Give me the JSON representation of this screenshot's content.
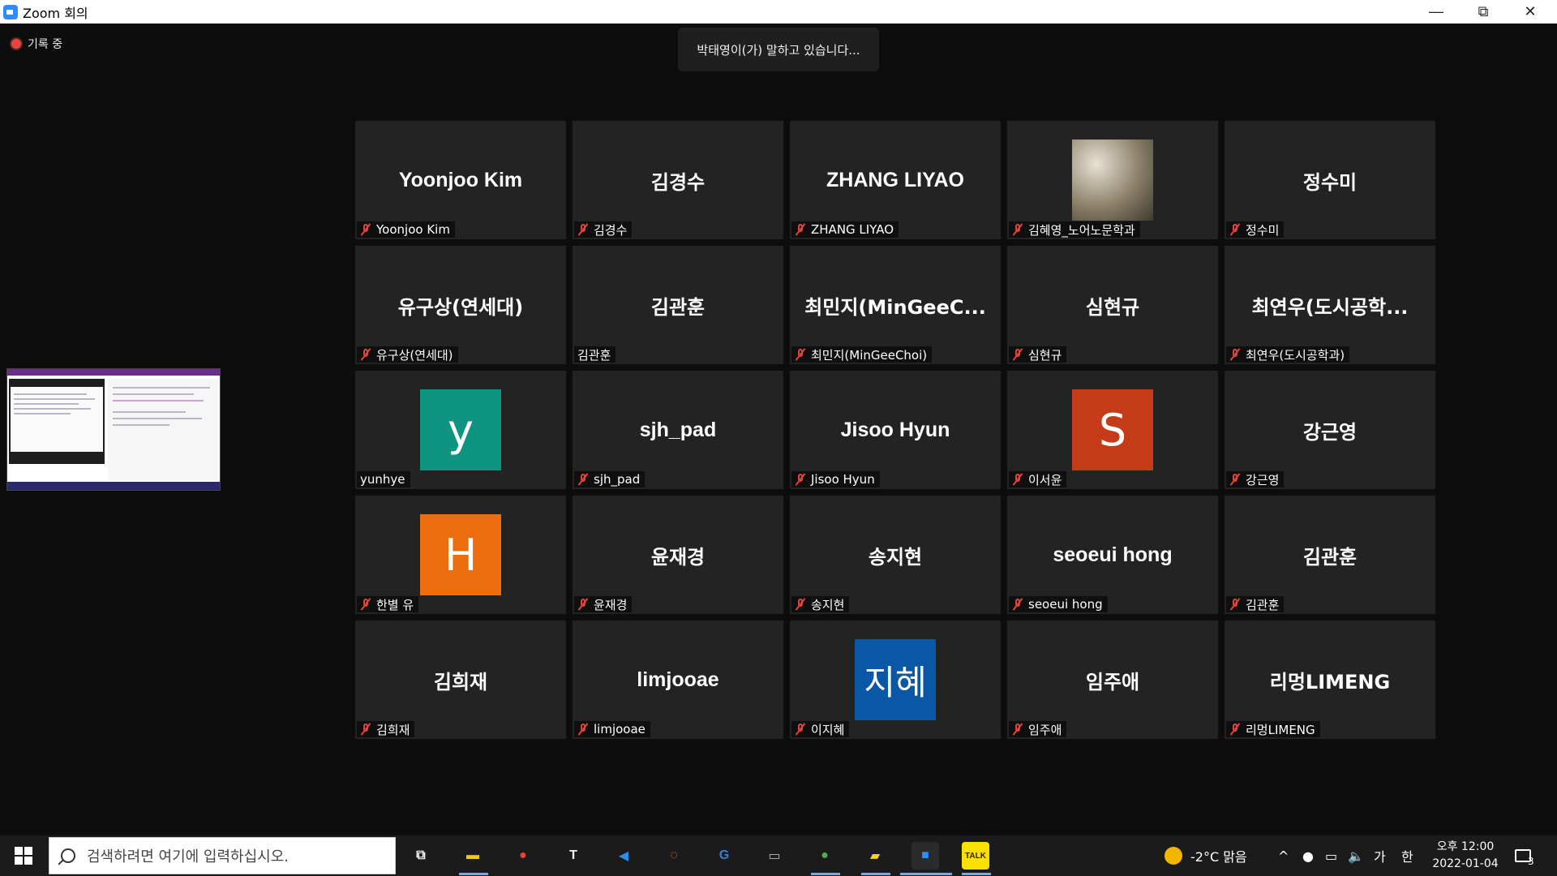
{
  "window": {
    "title": "Zoom 회의"
  },
  "meeting": {
    "recording_label": "기록 중",
    "speaking_banner": "박태영이(가) 말하고 있습니다...",
    "participants": [
      {
        "display": "Yoonjoo Kim",
        "name": "Yoonjoo Kim",
        "muted": true,
        "kind": "text"
      },
      {
        "display": "김경수",
        "name": "김경수",
        "muted": true,
        "kind": "text"
      },
      {
        "display": "ZHANG LIYAO",
        "name": "ZHANG LIYAO",
        "muted": true,
        "kind": "text"
      },
      {
        "display": "",
        "name": "김혜영_노어노문학과",
        "muted": true,
        "kind": "photo"
      },
      {
        "display": "정수미",
        "name": "정수미",
        "muted": true,
        "kind": "text"
      },
      {
        "display": "유구상(연세대)",
        "name": "유구상(연세대)",
        "muted": true,
        "kind": "text"
      },
      {
        "display": "김관훈",
        "name": "김관훈",
        "muted": false,
        "kind": "text"
      },
      {
        "display": "최민지(MinGeeC...",
        "name": "최민지(MinGeeChoi)",
        "muted": true,
        "kind": "text"
      },
      {
        "display": "심현규",
        "name": "심현규",
        "muted": true,
        "kind": "text"
      },
      {
        "display": "최연우(도시공학...",
        "name": "최연우(도시공학과)",
        "muted": true,
        "kind": "text"
      },
      {
        "display": "y",
        "name": "yunhye",
        "muted": false,
        "kind": "avatar",
        "color": "#0f9482"
      },
      {
        "display": "sjh_pad",
        "name": "sjh_pad",
        "muted": true,
        "kind": "text"
      },
      {
        "display": "Jisoo Hyun",
        "name": "Jisoo Hyun",
        "muted": true,
        "kind": "text"
      },
      {
        "display": "S",
        "name": "이서윤",
        "muted": true,
        "kind": "avatar",
        "color": "#c53a17"
      },
      {
        "display": "강근영",
        "name": "강근영",
        "muted": true,
        "kind": "text"
      },
      {
        "display": "H",
        "name": "한별 유",
        "muted": true,
        "kind": "avatar",
        "color": "#ec6c0e"
      },
      {
        "display": "윤재경",
        "name": "윤재경",
        "muted": true,
        "kind": "text"
      },
      {
        "display": "송지현",
        "name": "송지현",
        "muted": true,
        "kind": "text"
      },
      {
        "display": "seoeui hong",
        "name": "seoeui hong",
        "muted": true,
        "kind": "text"
      },
      {
        "display": "김관훈",
        "name": "김관훈",
        "muted": true,
        "kind": "text"
      },
      {
        "display": "김희재",
        "name": "김희재",
        "muted": true,
        "kind": "text"
      },
      {
        "display": "limjooae",
        "name": "limjooae",
        "muted": true,
        "kind": "text"
      },
      {
        "display": "지혜",
        "name": "이지혜",
        "muted": true,
        "kind": "avatar",
        "color": "#0a57a6"
      },
      {
        "display": "임주애",
        "name": "임주애",
        "muted": true,
        "kind": "text"
      },
      {
        "display": "리멍LIMENG",
        "name": "리멍LIMENG",
        "muted": true,
        "kind": "text"
      }
    ]
  },
  "taskbar": {
    "search_placeholder": "검색하려면 여기에 입력하십시오.",
    "weather": "-2°C 맑음",
    "ime_lang": "가",
    "ime_mode": "한",
    "time": "오후 12:00",
    "date": "2022-01-04",
    "notification_count": "3",
    "apps": [
      {
        "name": "task-view-icon",
        "label": "⧉",
        "color": "#ffffff"
      },
      {
        "name": "file-explorer-icon",
        "label": "▬",
        "color": "#f3c132"
      },
      {
        "name": "chrome-icon",
        "label": "●",
        "color": "#e84335"
      },
      {
        "name": "typora-icon",
        "label": "T",
        "color": "#f0f0f0"
      },
      {
        "name": "vscode-icon",
        "label": "◀",
        "color": "#2f8ee3"
      },
      {
        "name": "jupyter-icon",
        "label": "◌",
        "color": "#f37726"
      },
      {
        "name": "dictionary-icon",
        "label": "G",
        "color": "#3d7bd1"
      },
      {
        "name": "terminal-icon",
        "label": "▭",
        "color": "#b5b5b5"
      },
      {
        "name": "chrome-profile-icon",
        "label": "●",
        "color": "#4caf50"
      },
      {
        "name": "sticky-notes-icon",
        "label": "▰",
        "color": "#f7d21b"
      },
      {
        "name": "zoom-icon",
        "label": "■",
        "color": "#2d8cff"
      },
      {
        "name": "kakaotalk-icon",
        "label": "TALK",
        "color": "#f9e000"
      }
    ]
  }
}
